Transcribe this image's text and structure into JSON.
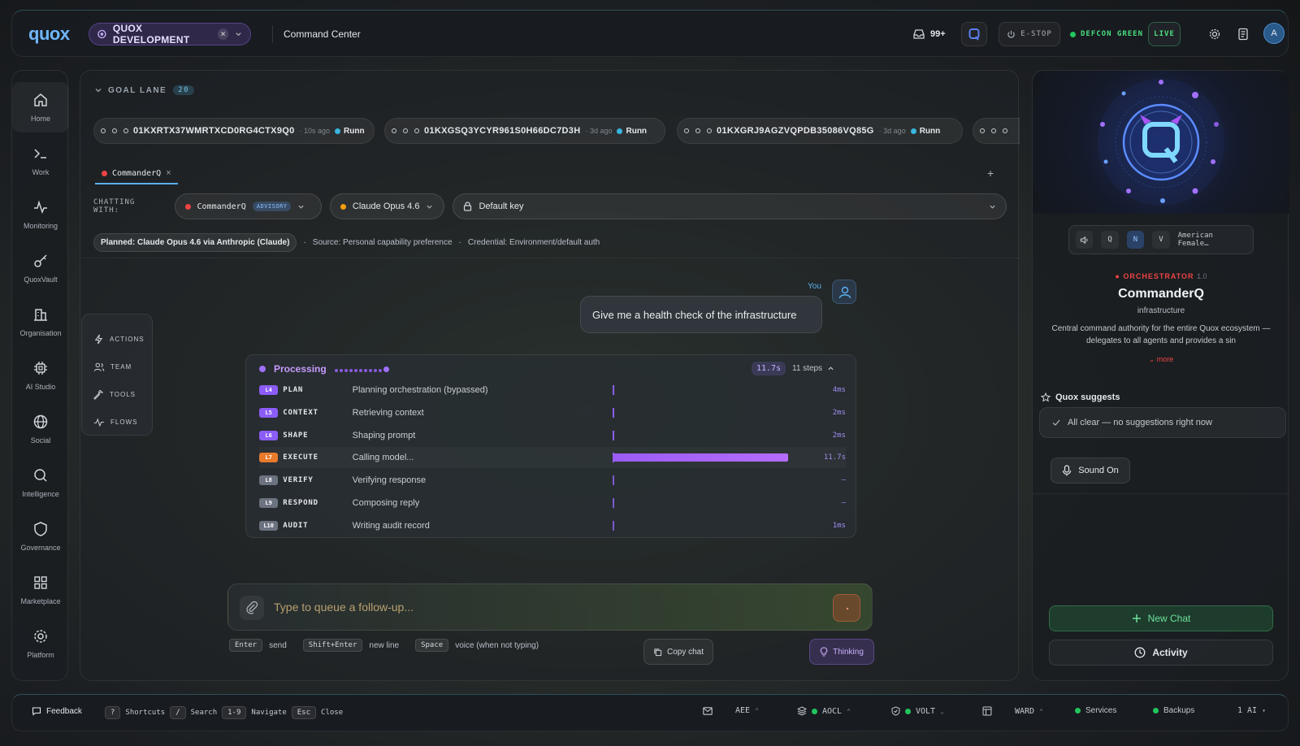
{
  "header": {
    "logo": "quox",
    "workspace": "QUOX DEVELOPMENT",
    "workspace_close": "×",
    "section": "Command Center",
    "inbox_count": "99+",
    "estop": "E-STOP",
    "defcon": "DEFCON GREEN",
    "live": "LIVE",
    "avatar": "A"
  },
  "nav": {
    "items": [
      {
        "label": "Home",
        "icon": "home-icon"
      },
      {
        "label": "Work",
        "icon": "terminal-icon"
      },
      {
        "label": "Monitoring",
        "icon": "activity-icon"
      },
      {
        "label": "QuoxVault",
        "icon": "key-icon"
      },
      {
        "label": "Organisation",
        "icon": "building-icon"
      },
      {
        "label": "AI Studio",
        "icon": "chip-icon"
      },
      {
        "label": "Social",
        "icon": "globe-icon"
      },
      {
        "label": "Intelligence",
        "icon": "search-icon"
      },
      {
        "label": "Governance",
        "icon": "shield-icon"
      },
      {
        "label": "Marketplace",
        "icon": "grid-icon"
      },
      {
        "label": "Platform",
        "icon": "gear-icon"
      }
    ]
  },
  "goal_lane": {
    "label": "GOAL LANE",
    "count": "20",
    "goals": [
      {
        "id": "01KXRTX37WMRTXCD0RG4CTX9Q0",
        "ago": "· 10s ago",
        "status": "Runn"
      },
      {
        "id": "01KXGSQ3YCYR961S0H66DC7D3H",
        "ago": "· 3d ago",
        "status": "Runn"
      },
      {
        "id": "01KXGRJ9AGZVQPDB35086VQ85G",
        "ago": "· 3d ago",
        "status": "Runn"
      }
    ]
  },
  "chat": {
    "tab": "CommanderQ",
    "tab_close": "×",
    "add_tab": "+",
    "chatting_with_label": "CHATTING WITH:",
    "agent": "CommanderQ",
    "agent_badge": "ADVISORY",
    "model": "Claude Opus 4.6",
    "key": "Default key",
    "planned": "Planned: Claude Opus 4.6 via Anthropic (Claude)",
    "source": "Source: Personal capability preference",
    "credential": "Credential: Environment/default auth",
    "sep": "·"
  },
  "actions": [
    {
      "label": "ACTIONS",
      "icon": "bolt-icon"
    },
    {
      "label": "TEAM",
      "icon": "users-icon"
    },
    {
      "label": "TOOLS",
      "icon": "wrench-icon"
    },
    {
      "label": "FLOWS",
      "icon": "flow-icon"
    }
  ],
  "message": {
    "author": "You",
    "text": "Give me a health check of the infrastructure"
  },
  "processing": {
    "label": "Processing",
    "time": "11.7s",
    "steps_label": "11 steps",
    "colors": {
      "active": "#8b5cf6",
      "done": "#6a4fd0",
      "execute": "#e87b2c",
      "pending": "#6b7280"
    },
    "steps": [
      {
        "level": "L4",
        "name": "PLAN",
        "desc": "Planning orchestration (bypassed)",
        "ms": "4ms",
        "state": "done",
        "fill": 0
      },
      {
        "level": "L5",
        "name": "CONTEXT",
        "desc": "Retrieving context",
        "ms": "2ms",
        "state": "done",
        "fill": 0
      },
      {
        "level": "L6",
        "name": "SHAPE",
        "desc": "Shaping prompt",
        "ms": "2ms",
        "state": "done",
        "fill": 0
      },
      {
        "level": "L7",
        "name": "EXECUTE",
        "desc": "Calling model...",
        "ms": "11.7s",
        "state": "execute",
        "fill": 1
      },
      {
        "level": "L8",
        "name": "VERIFY",
        "desc": "Verifying response",
        "ms": "—",
        "state": "pending",
        "fill": 0
      },
      {
        "level": "L9",
        "name": "RESPOND",
        "desc": "Composing reply",
        "ms": "—",
        "state": "pending",
        "fill": 0
      },
      {
        "level": "L10",
        "name": "AUDIT",
        "desc": "Writing audit record",
        "ms": "1ms",
        "state": "pending",
        "fill": 0
      }
    ]
  },
  "composer": {
    "placeholder": "Type to queue a follow-up...",
    "hints": [
      {
        "key": "Enter",
        "label": "send"
      },
      {
        "key": "Shift+Enter",
        "label": "new line"
      },
      {
        "key": "Space",
        "label": "voice (when not typing)"
      }
    ],
    "copy": "Copy chat",
    "thinking": "Thinking"
  },
  "agent_panel": {
    "voice": {
      "q": "Q",
      "n": "N",
      "v": "V",
      "name": "American Female…"
    },
    "role": "ORCHESTRATOR",
    "version": "1.0",
    "name": "CommanderQ",
    "subtitle": "infrastructure",
    "description": "Central command authority for the entire Quox ecosystem — delegates to all agents and provides a sin",
    "more": "more",
    "suggests_title": "Quox suggests",
    "suggestion": "All clear — no suggestions right now",
    "sound": "Sound On",
    "new_chat": "New Chat",
    "activity": "Activity"
  },
  "footer": {
    "feedback": "Feedback",
    "shortcuts": [
      {
        "key": "?",
        "label": "Shortcuts"
      },
      {
        "key": "/",
        "label": "Search"
      },
      {
        "key": "1-9",
        "label": "Navigate"
      },
      {
        "key": "Esc",
        "label": "Close"
      }
    ],
    "aee": "AEE",
    "aocl": "AOCL",
    "volt": "VOLT",
    "ward": "WARD",
    "services": "Services",
    "backups": "Backups",
    "ai": "1 AI"
  }
}
